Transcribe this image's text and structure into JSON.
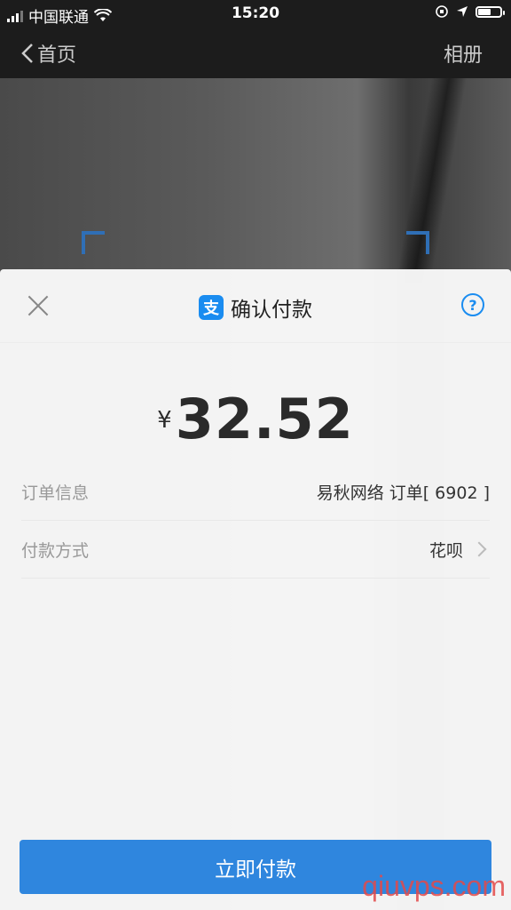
{
  "status": {
    "carrier": "中国联通",
    "time": "15:20"
  },
  "nav": {
    "back_label": "首页",
    "album_label": "相册"
  },
  "sheet": {
    "title": "确认付款",
    "logo_char": "支",
    "help_char": "?",
    "currency": "¥",
    "amount": "32.52",
    "rows": [
      {
        "label": "订单信息",
        "value": "易秋网络 订单[ 6902 ]"
      },
      {
        "label": "付款方式",
        "value": "花呗"
      }
    ],
    "pay_button": "立即付款"
  },
  "watermark": "qiuvps.com",
  "colors": {
    "accent": "#2f86de",
    "logo": "#1a8cf0"
  }
}
